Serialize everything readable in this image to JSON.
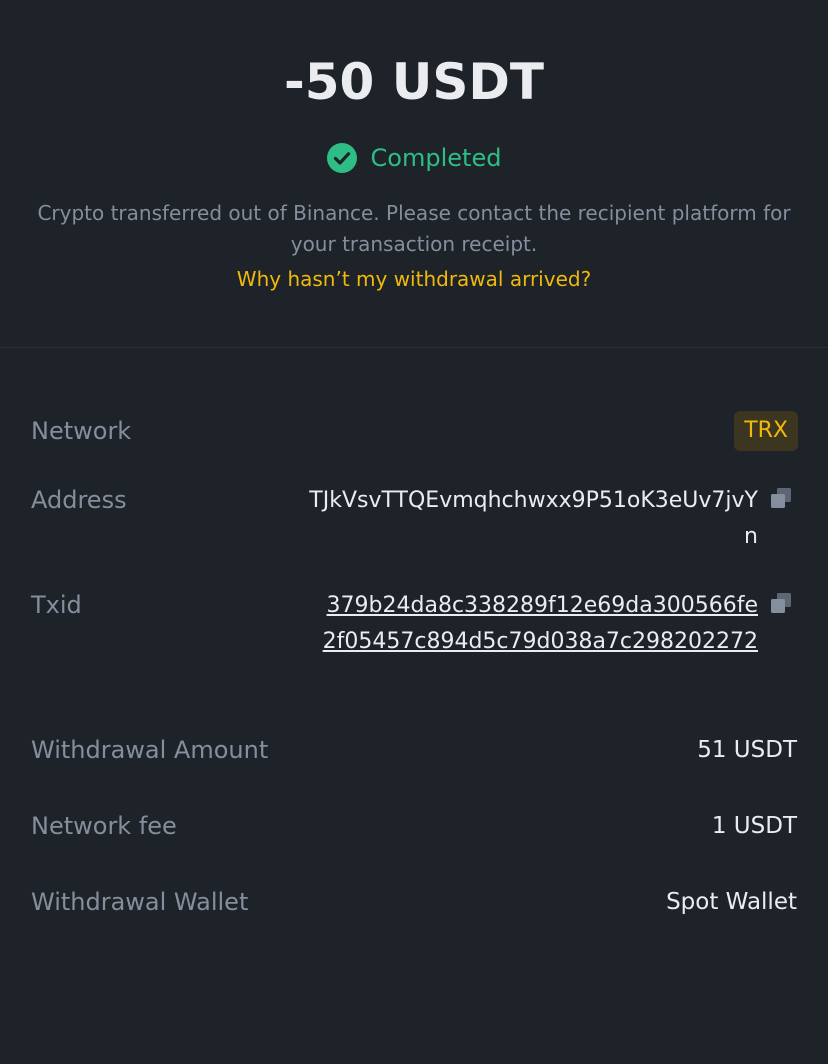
{
  "summary": {
    "amount": "-50 USDT",
    "status": "Completed",
    "note": "Crypto transferred out of Binance. Please contact the recipient platform for your transaction receipt.",
    "help_link": "Why hasn’t my withdrawal arrived?"
  },
  "details": {
    "network_label": "Network",
    "network_value": "TRX",
    "address_label": "Address",
    "address_value": "TJkVsvTTQEvmqhchwxx9P51oK3eUv7jvYn",
    "txid_label": "Txid",
    "txid_value": "379b24da8c338289f12e69da300566fe2f05457c894d5c79d038a7c298202272",
    "withdrawal_amount_label": "Withdrawal Amount",
    "withdrawal_amount_value": "51 USDT",
    "network_fee_label": "Network fee",
    "network_fee_value": "1 USDT",
    "wallet_label": "Withdrawal Wallet",
    "wallet_value": "Spot Wallet"
  },
  "icons": {
    "status": "check-circle-icon",
    "copy": "copy-icon"
  },
  "colors": {
    "background": "#1e2329",
    "primary_text": "#eaecef",
    "secondary_text": "#848e9c",
    "success": "#2ebd85",
    "accent": "#f0b90b"
  }
}
